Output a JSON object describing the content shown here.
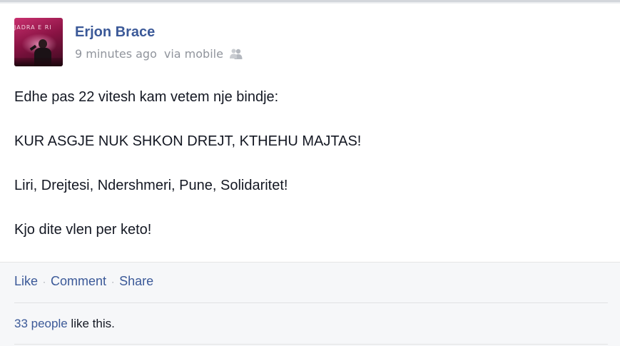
{
  "post": {
    "author": "Erjon Brace",
    "timestamp": "9 minutes ago",
    "via": "via mobile",
    "audience_icon": "friends-icon",
    "avatar_banner_text": "JADRA E RI",
    "paragraphs": [
      "Edhe pas 22 vitesh kam vetem nje bindje:",
      "KUR ASGJE NUK SHKON DREJT, KTHEHU MAJTAS!",
      "Liri, Drejtesi, Ndershmeri, Pune, Solidaritet!",
      "Kjo dite vlen per keto!"
    ]
  },
  "actions": {
    "like": "Like",
    "comment": "Comment",
    "share": "Share",
    "separator": "·"
  },
  "likes": {
    "count_text": "33 people",
    "suffix": " like this."
  },
  "colors": {
    "link": "#3b5998",
    "meta": "#90949c",
    "text": "#141823",
    "footer_bg": "#f6f7f9"
  }
}
